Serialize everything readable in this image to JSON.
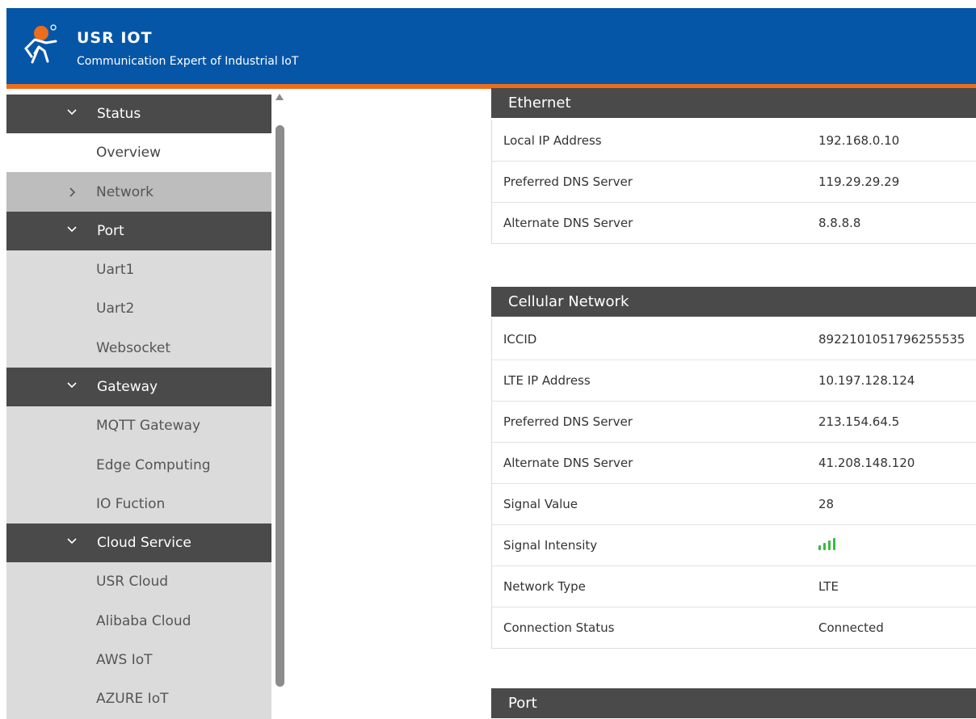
{
  "brand": {
    "title": "USR IOT",
    "subtitle": "Communication Expert of Industrial IoT",
    "colors": {
      "header": "#0656a8",
      "accent": "#ec6d1a"
    }
  },
  "sidebar": {
    "groups": [
      {
        "label": "Status",
        "items": [
          {
            "label": "Overview",
            "active": true
          },
          {
            "label": "Network",
            "collapsed": true
          }
        ]
      },
      {
        "label": "Port",
        "items": [
          {
            "label": "Uart1"
          },
          {
            "label": "Uart2"
          },
          {
            "label": "Websocket"
          }
        ]
      },
      {
        "label": "Gateway",
        "items": [
          {
            "label": "MQTT Gateway"
          },
          {
            "label": "Edge Computing"
          },
          {
            "label": "IO Fuction"
          }
        ]
      },
      {
        "label": "Cloud Service",
        "items": [
          {
            "label": "USR Cloud"
          },
          {
            "label": "Alibaba Cloud"
          },
          {
            "label": "AWS IoT"
          },
          {
            "label": "AZURE IoT"
          }
        ]
      }
    ]
  },
  "ethernet": {
    "title": "Ethernet",
    "rows": [
      {
        "key": "Local IP Address",
        "value": "192.168.0.10"
      },
      {
        "key": "Preferred DNS Server",
        "value": "119.29.29.29"
      },
      {
        "key": "Alternate DNS Server",
        "value": "8.8.8.8"
      }
    ]
  },
  "cellular": {
    "title": "Cellular Network",
    "rows": [
      {
        "key": "ICCID",
        "value": "8922101051796255535"
      },
      {
        "key": "LTE IP Address",
        "value": "10.197.128.124"
      },
      {
        "key": "Preferred DNS Server",
        "value": "213.154.64.5"
      },
      {
        "key": "Alternate DNS Server",
        "value": "41.208.148.120"
      },
      {
        "key": "Signal Value",
        "value": "28"
      },
      {
        "key": "Signal Intensity",
        "value": "",
        "signal_bars": 4,
        "signal_color": "#3cb843"
      },
      {
        "key": "Network Type",
        "value": "LTE"
      },
      {
        "key": "Connection Status",
        "value": "Connected"
      }
    ]
  },
  "port": {
    "title": "Port"
  }
}
